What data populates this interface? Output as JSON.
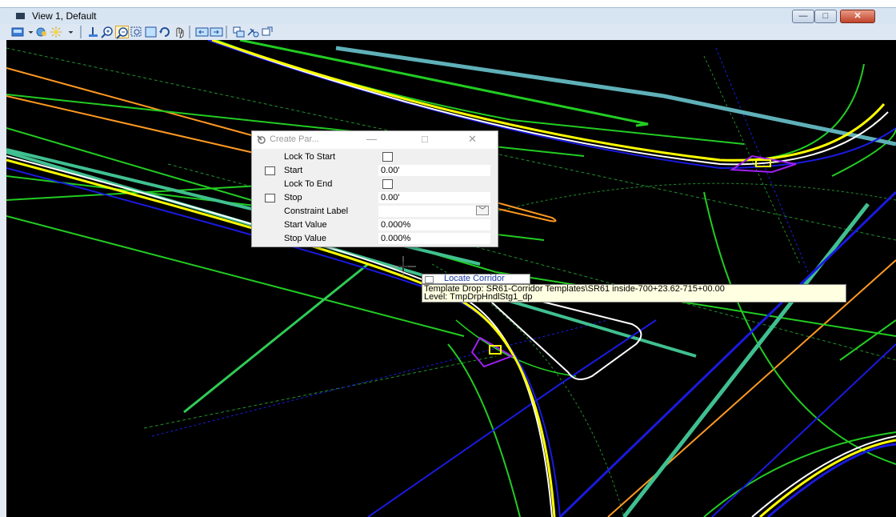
{
  "window": {
    "title": "View 1, Default",
    "controls": {
      "minimize": "—",
      "maximize": "□",
      "close": "✕"
    }
  },
  "toolbar": {
    "tools": [
      {
        "name": "view-attributes-icon"
      },
      {
        "name": "dropdown-arrow-icon"
      },
      {
        "name": "render-display-icon"
      },
      {
        "name": "lighting-icon"
      },
      {
        "name": "dropdown-arrow-icon"
      },
      {
        "name": "update-view-icon"
      },
      {
        "name": "zoom-in-icon"
      },
      {
        "name": "zoom-out-icon",
        "active": true
      },
      {
        "name": "window-area-icon"
      },
      {
        "name": "fit-view-icon"
      },
      {
        "name": "rotate-view-icon"
      },
      {
        "name": "pan-view-icon"
      },
      {
        "name": "view-previous-icon"
      },
      {
        "name": "view-next-icon"
      },
      {
        "name": "copy-view-icon"
      },
      {
        "name": "camera-icon"
      },
      {
        "name": "view-properties-icon"
      }
    ]
  },
  "dialog": {
    "title": "Create Par...",
    "rows": [
      {
        "label": "Lock To Start",
        "has_checkbox": false,
        "kind": "checkbox"
      },
      {
        "label": "Start",
        "has_checkbox": true,
        "kind": "text",
        "value": "0.00'"
      },
      {
        "label": "Lock To End",
        "has_checkbox": false,
        "kind": "checkbox"
      },
      {
        "label": "Stop",
        "has_checkbox": true,
        "kind": "text",
        "value": "0.00'"
      },
      {
        "label": "Constraint Label",
        "has_checkbox": false,
        "kind": "dropdown",
        "value": ""
      },
      {
        "label": "Start Value",
        "has_checkbox": false,
        "kind": "text",
        "value": "0.000%"
      },
      {
        "label": "Stop Value",
        "has_checkbox": false,
        "kind": "text",
        "value": "0.000%"
      }
    ]
  },
  "tooltip": {
    "title": "Locate Corridor",
    "line1": "Template Drop: SR61-Corridor Templates\\SR61 inside-700+23.62-715+00.00",
    "line2": "Level: TmpDrpHndlStg1_dp"
  },
  "colors": {
    "canvas": "#000000",
    "alignment": "#ffff00",
    "edge_white": "#ffffff",
    "edge_blue": "#1a1aff",
    "green": "#22cc22",
    "teal": "#40c090",
    "orange": "#ff9922",
    "purple": "#8a2be2"
  }
}
